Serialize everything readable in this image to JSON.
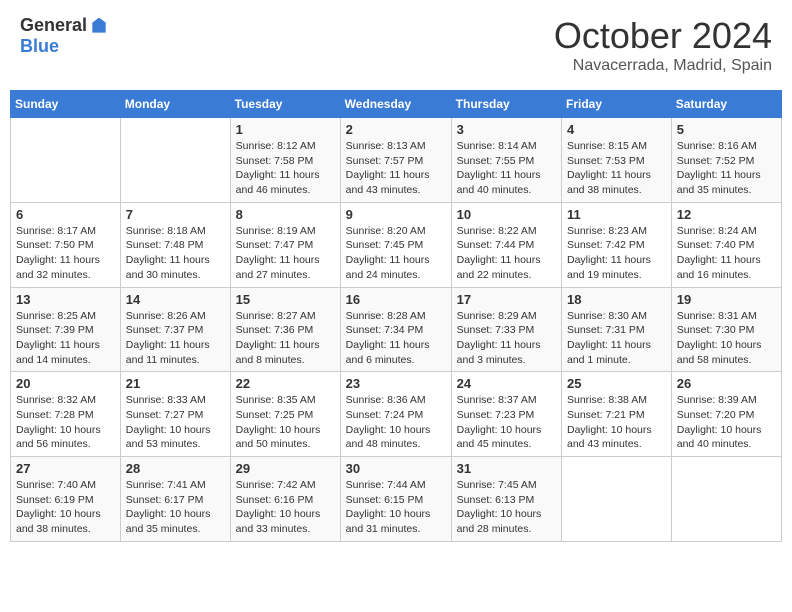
{
  "header": {
    "logo_general": "General",
    "logo_blue": "Blue",
    "month": "October 2024",
    "location": "Navacerrada, Madrid, Spain"
  },
  "days_of_week": [
    "Sunday",
    "Monday",
    "Tuesday",
    "Wednesday",
    "Thursday",
    "Friday",
    "Saturday"
  ],
  "weeks": [
    [
      {
        "day": "",
        "info": ""
      },
      {
        "day": "",
        "info": ""
      },
      {
        "day": "1",
        "sunrise": "8:12 AM",
        "sunset": "7:58 PM",
        "daylight": "11 hours and 46 minutes."
      },
      {
        "day": "2",
        "sunrise": "8:13 AM",
        "sunset": "7:57 PM",
        "daylight": "11 hours and 43 minutes."
      },
      {
        "day": "3",
        "sunrise": "8:14 AM",
        "sunset": "7:55 PM",
        "daylight": "11 hours and 40 minutes."
      },
      {
        "day": "4",
        "sunrise": "8:15 AM",
        "sunset": "7:53 PM",
        "daylight": "11 hours and 38 minutes."
      },
      {
        "day": "5",
        "sunrise": "8:16 AM",
        "sunset": "7:52 PM",
        "daylight": "11 hours and 35 minutes."
      }
    ],
    [
      {
        "day": "6",
        "sunrise": "8:17 AM",
        "sunset": "7:50 PM",
        "daylight": "11 hours and 32 minutes."
      },
      {
        "day": "7",
        "sunrise": "8:18 AM",
        "sunset": "7:48 PM",
        "daylight": "11 hours and 30 minutes."
      },
      {
        "day": "8",
        "sunrise": "8:19 AM",
        "sunset": "7:47 PM",
        "daylight": "11 hours and 27 minutes."
      },
      {
        "day": "9",
        "sunrise": "8:20 AM",
        "sunset": "7:45 PM",
        "daylight": "11 hours and 24 minutes."
      },
      {
        "day": "10",
        "sunrise": "8:22 AM",
        "sunset": "7:44 PM",
        "daylight": "11 hours and 22 minutes."
      },
      {
        "day": "11",
        "sunrise": "8:23 AM",
        "sunset": "7:42 PM",
        "daylight": "11 hours and 19 minutes."
      },
      {
        "day": "12",
        "sunrise": "8:24 AM",
        "sunset": "7:40 PM",
        "daylight": "11 hours and 16 minutes."
      }
    ],
    [
      {
        "day": "13",
        "sunrise": "8:25 AM",
        "sunset": "7:39 PM",
        "daylight": "11 hours and 14 minutes."
      },
      {
        "day": "14",
        "sunrise": "8:26 AM",
        "sunset": "7:37 PM",
        "daylight": "11 hours and 11 minutes."
      },
      {
        "day": "15",
        "sunrise": "8:27 AM",
        "sunset": "7:36 PM",
        "daylight": "11 hours and 8 minutes."
      },
      {
        "day": "16",
        "sunrise": "8:28 AM",
        "sunset": "7:34 PM",
        "daylight": "11 hours and 6 minutes."
      },
      {
        "day": "17",
        "sunrise": "8:29 AM",
        "sunset": "7:33 PM",
        "daylight": "11 hours and 3 minutes."
      },
      {
        "day": "18",
        "sunrise": "8:30 AM",
        "sunset": "7:31 PM",
        "daylight": "11 hours and 1 minute."
      },
      {
        "day": "19",
        "sunrise": "8:31 AM",
        "sunset": "7:30 PM",
        "daylight": "10 hours and 58 minutes."
      }
    ],
    [
      {
        "day": "20",
        "sunrise": "8:32 AM",
        "sunset": "7:28 PM",
        "daylight": "10 hours and 56 minutes."
      },
      {
        "day": "21",
        "sunrise": "8:33 AM",
        "sunset": "7:27 PM",
        "daylight": "10 hours and 53 minutes."
      },
      {
        "day": "22",
        "sunrise": "8:35 AM",
        "sunset": "7:25 PM",
        "daylight": "10 hours and 50 minutes."
      },
      {
        "day": "23",
        "sunrise": "8:36 AM",
        "sunset": "7:24 PM",
        "daylight": "10 hours and 48 minutes."
      },
      {
        "day": "24",
        "sunrise": "8:37 AM",
        "sunset": "7:23 PM",
        "daylight": "10 hours and 45 minutes."
      },
      {
        "day": "25",
        "sunrise": "8:38 AM",
        "sunset": "7:21 PM",
        "daylight": "10 hours and 43 minutes."
      },
      {
        "day": "26",
        "sunrise": "8:39 AM",
        "sunset": "7:20 PM",
        "daylight": "10 hours and 40 minutes."
      }
    ],
    [
      {
        "day": "27",
        "sunrise": "7:40 AM",
        "sunset": "6:19 PM",
        "daylight": "10 hours and 38 minutes."
      },
      {
        "day": "28",
        "sunrise": "7:41 AM",
        "sunset": "6:17 PM",
        "daylight": "10 hours and 35 minutes."
      },
      {
        "day": "29",
        "sunrise": "7:42 AM",
        "sunset": "6:16 PM",
        "daylight": "10 hours and 33 minutes."
      },
      {
        "day": "30",
        "sunrise": "7:44 AM",
        "sunset": "6:15 PM",
        "daylight": "10 hours and 31 minutes."
      },
      {
        "day": "31",
        "sunrise": "7:45 AM",
        "sunset": "6:13 PM",
        "daylight": "10 hours and 28 minutes."
      },
      {
        "day": "",
        "info": ""
      },
      {
        "day": "",
        "info": ""
      }
    ]
  ]
}
